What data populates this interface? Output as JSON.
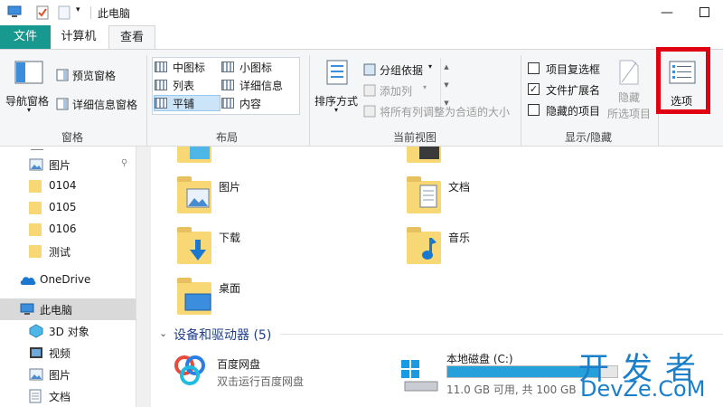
{
  "window": {
    "title": "此电脑",
    "minimize": "—"
  },
  "tabs": {
    "file": "文件",
    "computer": "计算机",
    "view": "查看"
  },
  "ribbon": {
    "panes": {
      "navigation_pane": "导航窗格",
      "preview_pane": "预览窗格",
      "details_pane": "详细信息窗格",
      "group_label": "窗格"
    },
    "layout": {
      "medium_icons": "中图标",
      "small_icons": "小图标",
      "list": "列表",
      "details": "详细信息",
      "tiles": "平铺",
      "content": "内容",
      "group_label": "布局",
      "selected": "tiles"
    },
    "current_view": {
      "sort_by": "排序方式",
      "group_by": "分组依据",
      "add_columns": "添加列",
      "size_all_columns": "将所有列调整为合适的大小",
      "group_label": "当前视图"
    },
    "show_hide": {
      "item_check_boxes": {
        "label": "项目复选框",
        "checked": false
      },
      "file_name_extensions": {
        "label": "文件扩展名",
        "checked": true
      },
      "hidden_items": {
        "label": "隐藏的项目",
        "checked": false
      },
      "hide_selected_line1": "隐藏",
      "hide_selected_line2": "所选项目",
      "group_label": "显示/隐藏"
    },
    "options": {
      "label": "选项",
      "highlight_color": "#e00012"
    }
  },
  "sidebar": {
    "items": [
      {
        "label": "图片",
        "icon": "pictures-icon",
        "pinned": true
      },
      {
        "label": "0104",
        "icon": "folder-icon"
      },
      {
        "label": "0105",
        "icon": "folder-icon"
      },
      {
        "label": "0106",
        "icon": "folder-icon"
      },
      {
        "label": "测试",
        "icon": "folder-icon"
      },
      {
        "label": "OneDrive",
        "icon": "onedrive-icon"
      },
      {
        "label": "此电脑",
        "icon": "this-pc-icon",
        "selected": true
      },
      {
        "label": "3D 对象",
        "icon": "3d-objects-icon"
      },
      {
        "label": "视频",
        "icon": "videos-icon"
      },
      {
        "label": "图片",
        "icon": "pictures-icon"
      },
      {
        "label": "文档",
        "icon": "documents-icon"
      }
    ]
  },
  "main": {
    "folders": [
      {
        "label": "图片",
        "icon": "pictures-folder-icon"
      },
      {
        "label": "文档",
        "icon": "documents-folder-icon"
      },
      {
        "label": "下载",
        "icon": "downloads-folder-icon"
      },
      {
        "label": "音乐",
        "icon": "music-folder-icon"
      },
      {
        "label": "桌面",
        "icon": "desktop-folder-icon"
      }
    ],
    "devices_header": "设备和驱动器 (5)",
    "devices": [
      {
        "name": "百度网盘",
        "subtitle": "双击运行百度网盘",
        "icon": "baidu-netdisk-icon"
      },
      {
        "name": "本地磁盘 (C:)",
        "subtitle": "11.0 GB 可用, 共 100 GB",
        "icon": "local-disk-icon",
        "used_fraction": 0.89
      }
    ]
  },
  "watermark": {
    "line1": "开发者",
    "line2": "DevZe.CoM"
  },
  "colors": {
    "file_tab": "#17998f",
    "accent": "#26a0da",
    "section_header": "#1e3f8b",
    "watermark": "#1a7fc9"
  }
}
